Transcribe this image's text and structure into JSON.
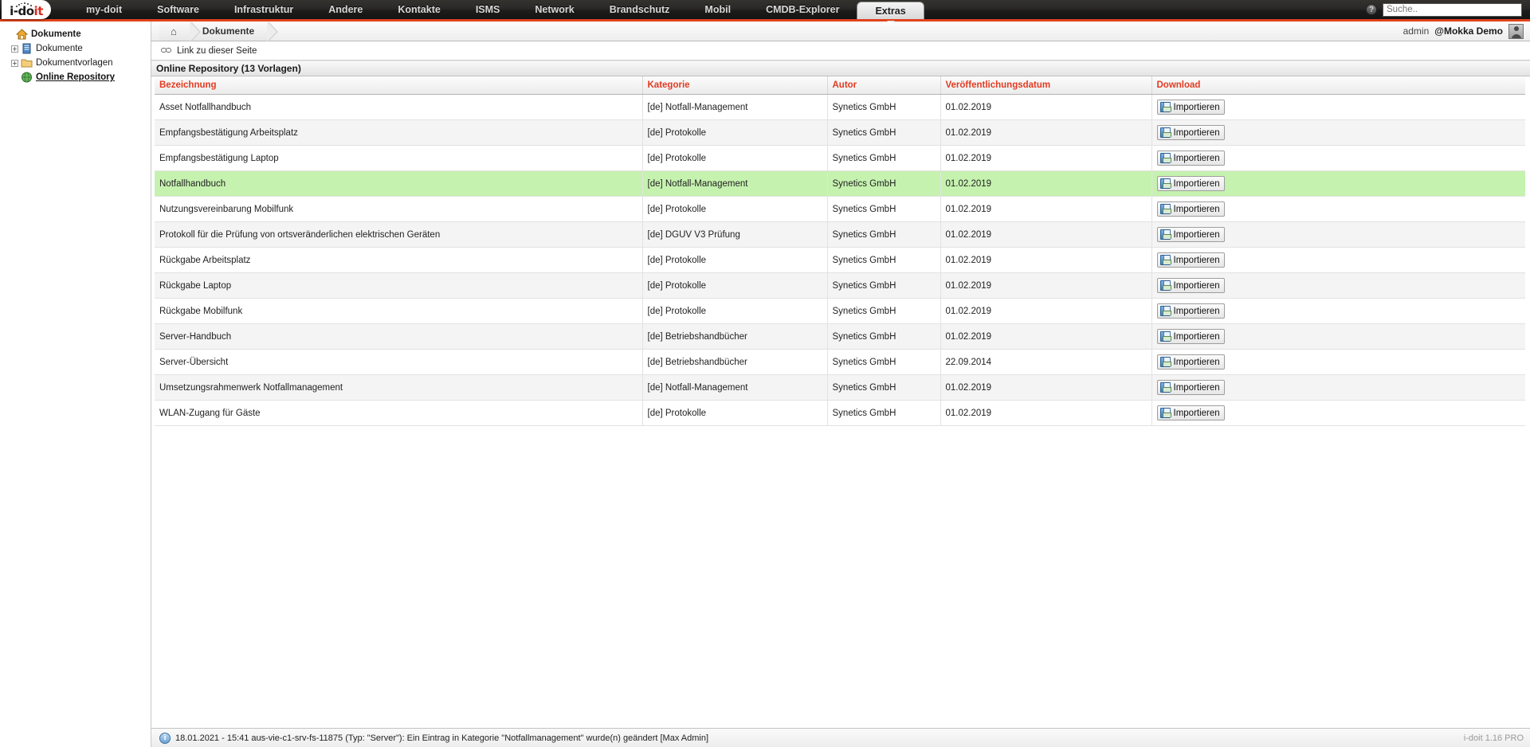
{
  "topnav": {
    "logo": {
      "part1": "i-do",
      "part2": "it"
    },
    "items": [
      {
        "label": "my-doit",
        "active": false
      },
      {
        "label": "Software",
        "active": false
      },
      {
        "label": "Infrastruktur",
        "active": false
      },
      {
        "label": "Andere",
        "active": false
      },
      {
        "label": "Kontakte",
        "active": false
      },
      {
        "label": "ISMS",
        "active": false
      },
      {
        "label": "Network",
        "active": false
      },
      {
        "label": "Brandschutz",
        "active": false
      },
      {
        "label": "Mobil",
        "active": false
      },
      {
        "label": "CMDB-Explorer",
        "active": false
      },
      {
        "label": "Extras",
        "active": true
      }
    ],
    "help_icon_glyph": "?",
    "search": {
      "value": "",
      "placeholder": "Suche.."
    }
  },
  "sidebar": {
    "items": [
      {
        "label": "Dokumente",
        "icon": "home-icon",
        "expander": "",
        "style": "bold",
        "indent": 0
      },
      {
        "label": "Dokumente",
        "icon": "book-icon",
        "expander": "+",
        "style": "normal",
        "indent": 1
      },
      {
        "label": "Dokumentvorlagen",
        "icon": "folder-icon",
        "expander": "+",
        "style": "normal",
        "indent": 1
      },
      {
        "label": "Online Repository",
        "icon": "globe-icon",
        "expander": "",
        "style": "selected",
        "indent": 1
      }
    ]
  },
  "breadcrumb": {
    "home_glyph": "⌂",
    "items": [
      "Dokumente"
    ],
    "user": "admin",
    "tenant": "@Mokka Demo"
  },
  "linkbar": {
    "label": "Link zu dieser Seite"
  },
  "section": {
    "title": "Online Repository (13 Vorlagen)"
  },
  "table": {
    "headers": [
      "Bezeichnung",
      "Kategorie",
      "Autor",
      "Veröffentlichungsdatum",
      "Download"
    ],
    "download_button_label": "Importieren",
    "rows": [
      {
        "bezeichnung": "Asset Notfallhandbuch",
        "kategorie": "[de] Notfall-Management",
        "autor": "Synetics GmbH",
        "datum": "01.02.2019",
        "highlight": false
      },
      {
        "bezeichnung": "Empfangsbestätigung Arbeitsplatz",
        "kategorie": "[de] Protokolle",
        "autor": "Synetics GmbH",
        "datum": "01.02.2019",
        "highlight": false
      },
      {
        "bezeichnung": "Empfangsbestätigung Laptop",
        "kategorie": "[de] Protokolle",
        "autor": "Synetics GmbH",
        "datum": "01.02.2019",
        "highlight": false
      },
      {
        "bezeichnung": "Notfallhandbuch",
        "kategorie": "[de] Notfall-Management",
        "autor": "Synetics GmbH",
        "datum": "01.02.2019",
        "highlight": true
      },
      {
        "bezeichnung": "Nutzungsvereinbarung Mobilfunk",
        "kategorie": "[de] Protokolle",
        "autor": "Synetics GmbH",
        "datum": "01.02.2019",
        "highlight": false
      },
      {
        "bezeichnung": "Protokoll für die Prüfung von ortsveränderlichen elektrischen Geräten",
        "kategorie": "[de] DGUV V3 Prüfung",
        "autor": "Synetics GmbH",
        "datum": "01.02.2019",
        "highlight": false
      },
      {
        "bezeichnung": "Rückgabe Arbeitsplatz",
        "kategorie": "[de] Protokolle",
        "autor": "Synetics GmbH",
        "datum": "01.02.2019",
        "highlight": false
      },
      {
        "bezeichnung": "Rückgabe Laptop",
        "kategorie": "[de] Protokolle",
        "autor": "Synetics GmbH",
        "datum": "01.02.2019",
        "highlight": false
      },
      {
        "bezeichnung": "Rückgabe Mobilfunk",
        "kategorie": "[de] Protokolle",
        "autor": "Synetics GmbH",
        "datum": "01.02.2019",
        "highlight": false
      },
      {
        "bezeichnung": "Server-Handbuch",
        "kategorie": "[de] Betriebshandbücher",
        "autor": "Synetics GmbH",
        "datum": "01.02.2019",
        "highlight": false
      },
      {
        "bezeichnung": "Server-Übersicht",
        "kategorie": "[de] Betriebshandbücher",
        "autor": "Synetics GmbH",
        "datum": "22.09.2014",
        "highlight": false
      },
      {
        "bezeichnung": "Umsetzungsrahmenwerk Notfallmanagement",
        "kategorie": "[de] Notfall-Management",
        "autor": "Synetics GmbH",
        "datum": "01.02.2019",
        "highlight": false
      },
      {
        "bezeichnung": "WLAN-Zugang für Gäste",
        "kategorie": "[de] Protokolle",
        "autor": "Synetics GmbH",
        "datum": "01.02.2019",
        "highlight": false
      }
    ]
  },
  "statusbar": {
    "icon_glyph": "i",
    "message": "18.01.2021 - 15:41 aus-vie-c1-srv-fs-11875 (Typ: \"Server\"): Ein Eintrag in Kategorie \"Notfallmanagement\" wurde(n) geändert [Max Admin]",
    "version": "i-doit 1.16 PRO"
  },
  "colors": {
    "accent": "#e0441c",
    "header_text": "#e23b22",
    "highlight_row": "#c6f2b0",
    "logo_red": "#d9291c"
  }
}
